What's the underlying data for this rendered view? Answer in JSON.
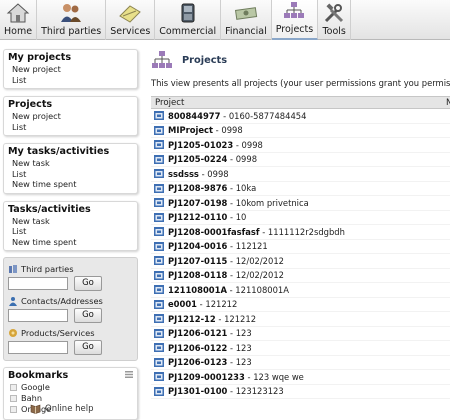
{
  "toolbar": {
    "items": [
      {
        "label": "Home",
        "icon": "home-icon"
      },
      {
        "label": "Third parties",
        "icon": "people-icon"
      },
      {
        "label": "Services",
        "icon": "services-icon"
      },
      {
        "label": "Commercial",
        "icon": "commercial-icon"
      },
      {
        "label": "Financial",
        "icon": "money-icon"
      },
      {
        "label": "Projects",
        "icon": "projects-icon"
      },
      {
        "label": "Tools",
        "icon": "tools-icon"
      }
    ]
  },
  "sidebar": {
    "my_projects": {
      "title": "My projects",
      "links": [
        "New project",
        "List"
      ]
    },
    "projects": {
      "title": "Projects",
      "links": [
        "New project",
        "List"
      ]
    },
    "my_tasks": {
      "title": "My tasks/activities",
      "links": [
        "New task",
        "List",
        "New time spent"
      ]
    },
    "tasks": {
      "title": "Tasks/activities",
      "links": [
        "New task",
        "List",
        "New time spent"
      ]
    },
    "search": {
      "third_parties_label": "Third parties",
      "contacts_label": "Contacts/Addresses",
      "products_label": "Products/Services",
      "go_label": "Go"
    },
    "bookmarks": {
      "title": "Bookmarks",
      "items": [
        "Google",
        "Bahn",
        "Orange"
      ]
    },
    "help_label": "Online help"
  },
  "main": {
    "title": "Projects",
    "intro": "This view presents all projects (your user permissions grant you permiss",
    "col_project": "Project",
    "col_next": "N",
    "rows": [
      {
        "ref": "800844977",
        "title": "0160-5877484454"
      },
      {
        "ref": "MIProject",
        "title": "0998"
      },
      {
        "ref": "PJ1205-01023",
        "title": "0998"
      },
      {
        "ref": "PJ1205-0224",
        "title": "0998"
      },
      {
        "ref": "ssdsss",
        "title": "0998"
      },
      {
        "ref": "PJ1208-9876",
        "title": "10ka"
      },
      {
        "ref": "PJ1207-0198",
        "title": "10kom privetnica"
      },
      {
        "ref": "PJ1212-0110",
        "title": "10"
      },
      {
        "ref": "PJ1208-0001fasfasf",
        "title": "1111112r2sdgbdh"
      },
      {
        "ref": "PJ1204-0016",
        "title": "112121"
      },
      {
        "ref": "PJ1207-0115",
        "title": "12/02/2012"
      },
      {
        "ref": "PJ1208-0118",
        "title": "12/02/2012"
      },
      {
        "ref": "121108001A",
        "title": "121108001A"
      },
      {
        "ref": "e0001",
        "title": "121212"
      },
      {
        "ref": "PJ1212-12",
        "title": "121212"
      },
      {
        "ref": "PJ1206-0121",
        "title": "123"
      },
      {
        "ref": "PJ1206-0122",
        "title": "123"
      },
      {
        "ref": "PJ1206-0123",
        "title": "123"
      },
      {
        "ref": "PJ1209-0001233",
        "title": "123 wqe we"
      },
      {
        "ref": "PJ1301-0100",
        "title": "123123123"
      }
    ],
    "separator": " - "
  }
}
